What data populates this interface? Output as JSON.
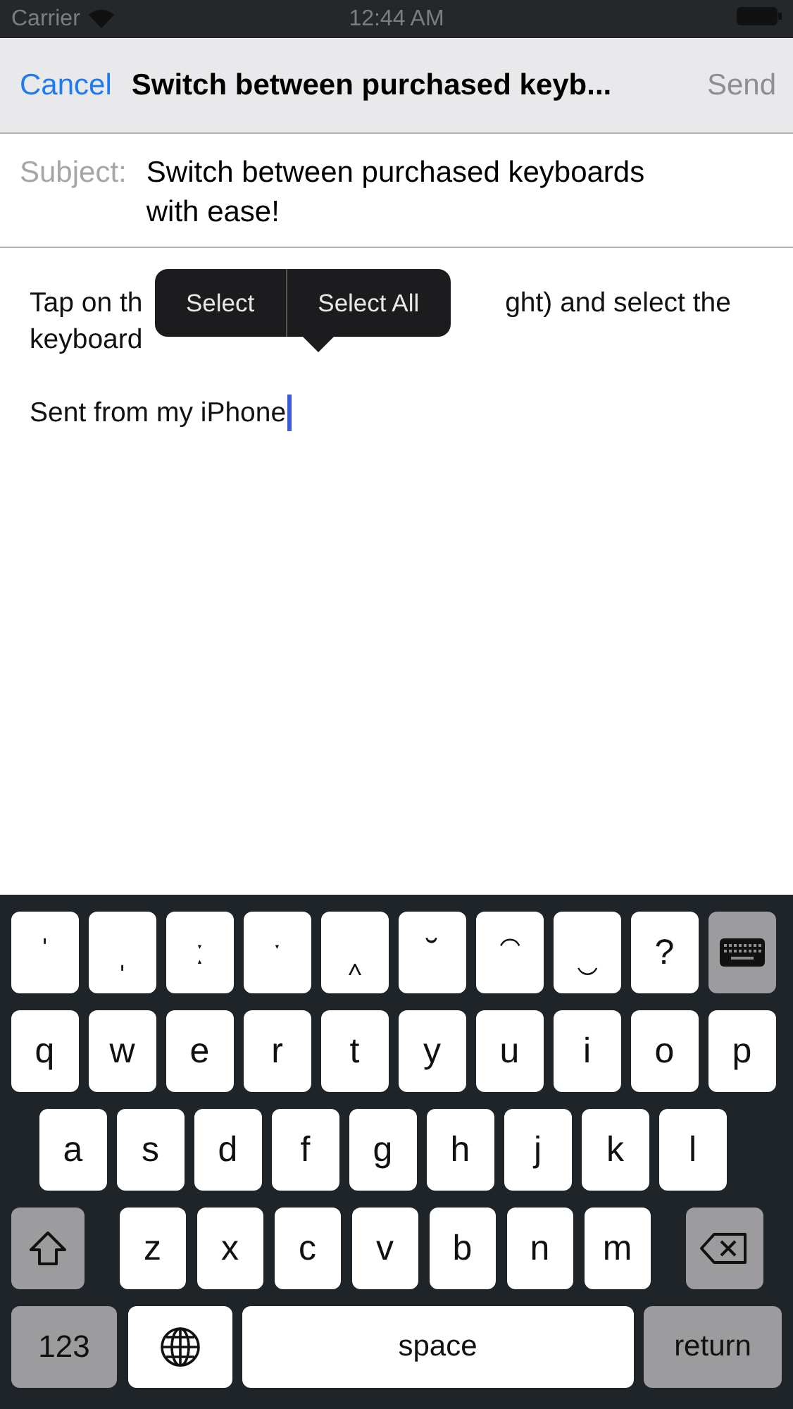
{
  "status_bar": {
    "carrier": "Carrier",
    "time": "12:44 AM"
  },
  "nav": {
    "cancel": "Cancel",
    "title": "Switch between purchased keyb...",
    "send": "Send",
    "send_disabled": true
  },
  "subject": {
    "label": "Subject:",
    "value": "Switch between purchased keyboards with ease!"
  },
  "body": {
    "line_1_start": "Tap on th",
    "line_1_end": "ght) and select the",
    "line_2": "keyboard",
    "signature": "Sent from my iPhone"
  },
  "edit_menu": [
    "Select",
    "Select All"
  ],
  "keyboard": {
    "rows": [
      {
        "keys": [
          {
            "kind": "char",
            "label": "ˈ"
          },
          {
            "kind": "char",
            "label": "ˌ"
          },
          {
            "kind": "char",
            "label": "ː"
          },
          {
            "kind": "char",
            "label": "ˑ"
          },
          {
            "kind": "char",
            "label": "‸"
          },
          {
            "kind": "char",
            "label": "˘"
          },
          {
            "kind": "char",
            "label": "⁀"
          },
          {
            "kind": "char",
            "label": "‿"
          },
          {
            "kind": "char",
            "label": "?"
          },
          {
            "kind": "dismiss"
          }
        ]
      },
      {
        "keys": [
          {
            "kind": "char",
            "label": "q"
          },
          {
            "kind": "char",
            "label": "w"
          },
          {
            "kind": "char",
            "label": "e"
          },
          {
            "kind": "char",
            "label": "r"
          },
          {
            "kind": "char",
            "label": "t"
          },
          {
            "kind": "char",
            "label": "y"
          },
          {
            "kind": "char",
            "label": "u"
          },
          {
            "kind": "char",
            "label": "i"
          },
          {
            "kind": "char",
            "label": "o"
          },
          {
            "kind": "char",
            "label": "p"
          }
        ]
      },
      {
        "keys": [
          {
            "kind": "char",
            "label": "a"
          },
          {
            "kind": "char",
            "label": "s"
          },
          {
            "kind": "char",
            "label": "d"
          },
          {
            "kind": "char",
            "label": "f"
          },
          {
            "kind": "char",
            "label": "g"
          },
          {
            "kind": "char",
            "label": "h"
          },
          {
            "kind": "char",
            "label": "j"
          },
          {
            "kind": "char",
            "label": "k"
          },
          {
            "kind": "char",
            "label": "l"
          }
        ]
      },
      {
        "keys": [
          {
            "kind": "shift"
          },
          {
            "kind": "char",
            "label": "z"
          },
          {
            "kind": "char",
            "label": "x"
          },
          {
            "kind": "char",
            "label": "c"
          },
          {
            "kind": "char",
            "label": "v"
          },
          {
            "kind": "char",
            "label": "b"
          },
          {
            "kind": "char",
            "label": "n"
          },
          {
            "kind": "char",
            "label": "m"
          },
          {
            "kind": "delete"
          }
        ]
      },
      {
        "keys": [
          {
            "kind": "mode",
            "label": "123"
          },
          {
            "kind": "globe"
          },
          {
            "kind": "space",
            "label": "space"
          },
          {
            "kind": "return",
            "label": "return"
          }
        ]
      }
    ]
  }
}
